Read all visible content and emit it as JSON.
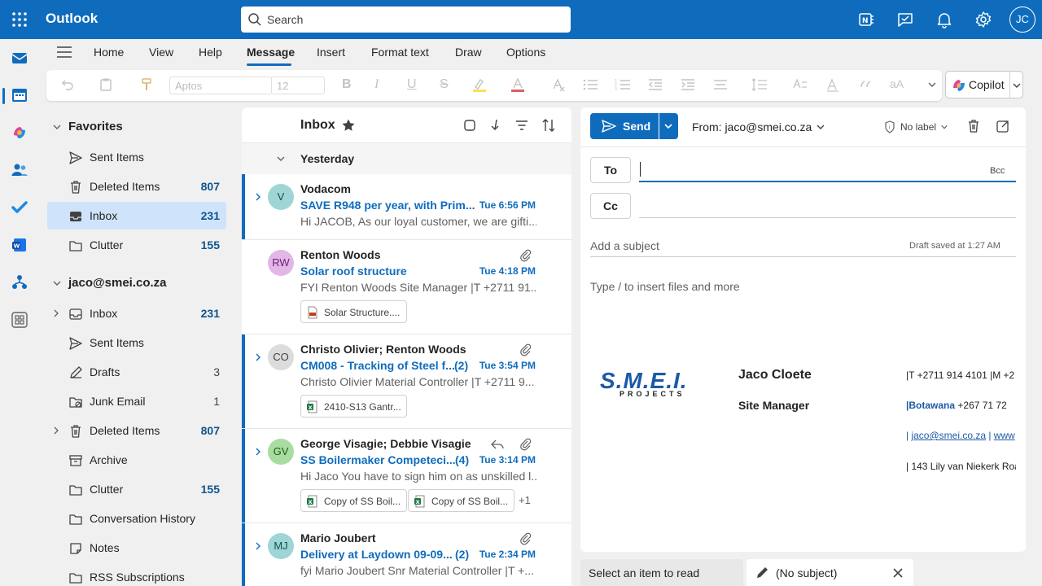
{
  "app": {
    "title": "Outlook",
    "user_initials": "JC"
  },
  "search": {
    "placeholder": "Search"
  },
  "ribbon": {
    "tabs": [
      "Home",
      "View",
      "Help",
      "Message",
      "Insert",
      "Format text",
      "Draw",
      "Options"
    ],
    "active_tab": "Message",
    "font_name": "Aptos",
    "font_size": "12",
    "copilot_label": "Copilot"
  },
  "folders": {
    "favorites_label": "Favorites",
    "favorites": [
      {
        "label": "Sent Items",
        "count": "",
        "icon": "send-icon"
      },
      {
        "label": "Deleted Items",
        "count": "807",
        "icon": "trash-icon"
      },
      {
        "label": "Inbox",
        "count": "231",
        "icon": "inbox-icon",
        "selected": true
      },
      {
        "label": "Clutter",
        "count": "155",
        "icon": "folder-icon"
      }
    ],
    "account_label": "jaco@smei.co.za",
    "account": [
      {
        "label": "Inbox",
        "count": "231",
        "icon": "inbox-icon",
        "expandable": true
      },
      {
        "label": "Sent Items",
        "count": "",
        "icon": "send-icon"
      },
      {
        "label": "Drafts",
        "count": "3",
        "icon": "drafts-icon"
      },
      {
        "label": "Junk Email",
        "count": "1",
        "icon": "junk-icon"
      },
      {
        "label": "Deleted Items",
        "count": "807",
        "icon": "trash-icon",
        "expandable": true
      },
      {
        "label": "Archive",
        "count": "",
        "icon": "archive-icon"
      },
      {
        "label": "Clutter",
        "count": "155",
        "icon": "folder-icon"
      },
      {
        "label": "Conversation History",
        "count": "",
        "icon": "folder-icon"
      },
      {
        "label": "Notes",
        "count": "",
        "icon": "notes-icon"
      },
      {
        "label": "RSS Subscriptions",
        "count": "",
        "icon": "folder-icon"
      }
    ]
  },
  "message_list": {
    "title": "Inbox",
    "group_label": "Yesterday",
    "messages": [
      {
        "initials": "V",
        "avatar_bg": "#9fd5d5",
        "avatar_fg": "#0e4f4f",
        "sender": "Vodacom",
        "subject": "SAVE R948 per year, with Prim...",
        "count": "",
        "time": "Tue 6:56 PM",
        "preview": "Hi JACOB, As our loyal customer, we are gifti..."
      },
      {
        "initials": "RW",
        "avatar_bg": "#e3b6e8",
        "avatar_fg": "#6b2675",
        "sender": "Renton Woods",
        "subject": "Solar roof structure",
        "count": "",
        "time": "Tue 4:18 PM",
        "preview": "FYI Renton Woods Site Manager |T +2711 91...",
        "attachments": [
          "Solar Structure...."
        ]
      },
      {
        "initials": "CO",
        "avatar_bg": "#dcdcdc",
        "avatar_fg": "#424242",
        "sender": "Christo Olivier; Renton Woods",
        "subject": "CM008 - Tracking of Steel f...",
        "count": "(2)",
        "time": "Tue 3:54 PM",
        "preview": "Christo Olivier Material Controller |T +2711 9...",
        "attachments": [
          "2410-S13 Gantr..."
        ]
      },
      {
        "initials": "GV",
        "avatar_bg": "#a9dca0",
        "avatar_fg": "#1f5a16",
        "sender": "George Visagie; Debbie Visagie",
        "subject": "SS Boilermaker Competeci...",
        "count": "(4)",
        "time": "Tue 3:14 PM",
        "preview": "Hi Jaco You have to sign him on as unskilled l...",
        "attachments": [
          "Copy of SS Boil...",
          "Copy of SS Boil..."
        ],
        "more": "+1"
      },
      {
        "initials": "MJ",
        "avatar_bg": "#9fd5d5",
        "avatar_fg": "#0e4f4f",
        "sender": "Mario Joubert",
        "subject": "Delivery at Laydown 09-09...",
        "count": "(2)",
        "time": "Tue 2:34 PM",
        "preview": "fyi Mario Joubert Snr Material Controller |T +..."
      }
    ]
  },
  "compose": {
    "send_label": "Send",
    "from_label": "From: jaco@smei.co.za",
    "label_label": "No label",
    "to_label": "To",
    "cc_label": "Cc",
    "bcc_label": "Bcc",
    "subject_placeholder": "Add a subject",
    "draft_saved": "Draft saved at 1:27 AM",
    "body_hint": "Type / to insert files and more",
    "signature": {
      "logo": "S.M.E.I.",
      "logo_sub": "PROJECTS",
      "name": "Jaco Cloete",
      "title": "Site Manager",
      "line1": "|T +2711 914 4101 |M +2",
      "line2_place": "|Botawana",
      "line2_phone": " +267 71 72",
      "line3_email": "jaco@smei.co.za",
      "line3_web": "www",
      "line4": "| 143 Lily van Niekerk Roa"
    }
  },
  "bottom": {
    "reading_label": "Select an item to read",
    "draft_label": "(No subject)"
  }
}
